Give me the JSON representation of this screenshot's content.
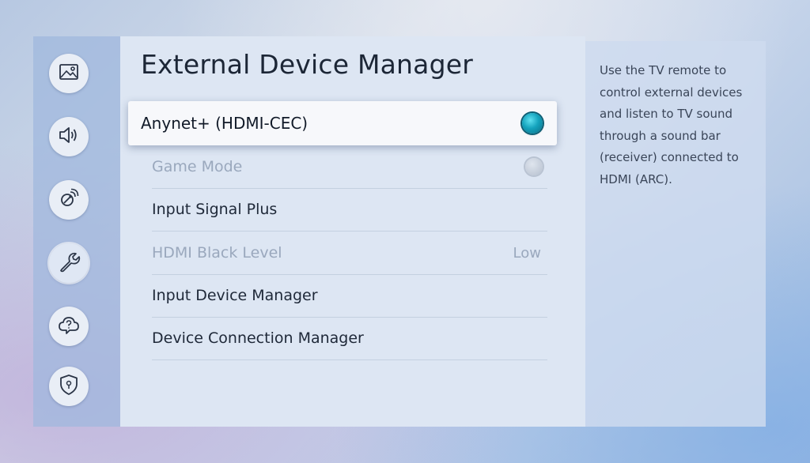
{
  "sidebar": {
    "items": [
      {
        "icon": "picture-icon"
      },
      {
        "icon": "sound-icon"
      },
      {
        "icon": "broadcast-icon"
      },
      {
        "icon": "wrench-icon",
        "active": true
      },
      {
        "icon": "support-icon"
      },
      {
        "icon": "privacy-icon"
      }
    ]
  },
  "panel": {
    "title": "External Device Manager",
    "items": [
      {
        "label": "Anynet+ (HDMI-CEC)",
        "toggle": "on",
        "state": "focused"
      },
      {
        "label": "Game Mode",
        "toggle": "off",
        "state": "disabled"
      },
      {
        "label": "Input Signal Plus",
        "state": "normal"
      },
      {
        "label": "HDMI Black Level",
        "value": "Low",
        "state": "disabled"
      },
      {
        "label": "Input Device Manager",
        "state": "normal"
      },
      {
        "label": "Device Connection Manager",
        "state": "normal"
      }
    ]
  },
  "description": {
    "text": "Use the TV remote to control external devices and listen to TV sound through a sound bar (receiver) connected to HDMI (ARC)."
  },
  "colors": {
    "toggle_on": "#14a3bd",
    "panel_bg": "#dde6f3",
    "text_primary": "#1e2838",
    "text_disabled": "#9aa8bd"
  }
}
